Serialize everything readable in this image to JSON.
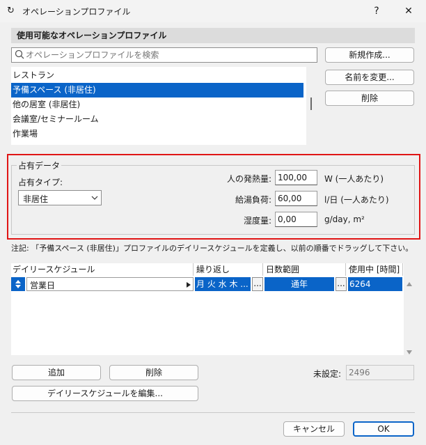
{
  "window": {
    "title": "オペレーションプロファイル",
    "help_label": "?",
    "close_label": "✕"
  },
  "profiles": {
    "section_label": "使用可能なオペレーションプロファイル",
    "search_placeholder": "オペレーションプロファイルを検索",
    "items": [
      {
        "label": "レストラン",
        "selected": false
      },
      {
        "label": "予備スペース (非居住)",
        "selected": true
      },
      {
        "label": "他の居室 (非居住)",
        "selected": false
      },
      {
        "label": "会議室/セミナールーム",
        "selected": false
      },
      {
        "label": "作業場",
        "selected": false
      }
    ],
    "new_button": "新規作成...",
    "rename_button": "名前を変更...",
    "delete_button": "削除"
  },
  "occupancy": {
    "group_label": "占有データ",
    "type_label": "占有タイプ:",
    "type_value": "非居住",
    "heat_label": "人の発熱量:",
    "heat_value": "100,00",
    "heat_unit": "W (一人あたり)",
    "water_label": "給湯負荷:",
    "water_value": "60,00",
    "water_unit": "l/日 (一人あたり)",
    "humidity_label": "湿度量:",
    "humidity_value": "0,00",
    "humidity_unit": "g/day, m²"
  },
  "note": "注記: 「予備スペース (非居住)」プロファイルのデイリースケジュールを定義し、以前の順番でドラッグして下さい。",
  "schedule": {
    "headers": [
      "デイリースケジュール",
      "繰り返し",
      "日数範囲",
      "使用中 [時間]"
    ],
    "row": {
      "name": "営業日",
      "repeat": "月 火 水 木 ...",
      "range": "通年",
      "hours": "6264",
      "more_label": "..."
    },
    "add_button": "追加",
    "delete_button": "削除",
    "edit_button": "デイリースケジュールを編集...",
    "unset_label": "未設定:",
    "unset_value": "2496"
  },
  "footer": {
    "cancel_button": "キャンセル",
    "ok_button": "OK"
  },
  "colors": {
    "selection": "#0a64c8",
    "highlight_border": "#e01515"
  }
}
